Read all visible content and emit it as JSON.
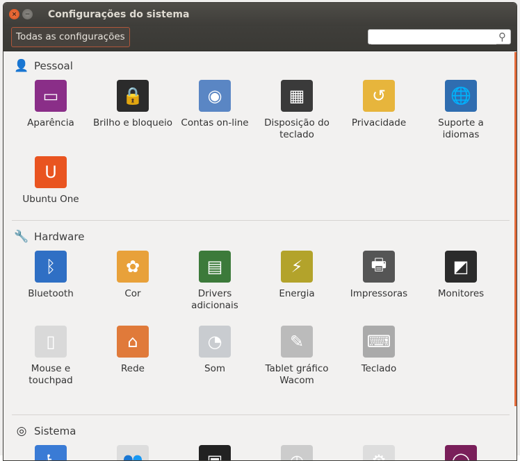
{
  "window": {
    "title": "Configurações do sistema",
    "close": "×",
    "minimize": "−"
  },
  "toolbar": {
    "all_settings": "Todas as configurações",
    "search_placeholder": "",
    "search_value": ""
  },
  "sections": [
    {
      "title": "Pessoal",
      "icon": "person-icon",
      "glyph": "👤",
      "items": [
        {
          "label": "Aparência",
          "icon": "appearance-icon",
          "color": "#8a2e88",
          "glyph": "▭"
        },
        {
          "label": "Brilho e bloqueio",
          "icon": "lock-screen-icon",
          "color": "#2b2b2b",
          "glyph": "🔒"
        },
        {
          "label": "Contas on-line",
          "icon": "online-accounts-icon",
          "color": "#5a86c4",
          "glyph": "◉"
        },
        {
          "label": "Disposição do teclado",
          "icon": "display-layout-icon",
          "color": "#3a3a3a",
          "glyph": "▦"
        },
        {
          "label": "Privacidade",
          "icon": "privacy-icon",
          "color": "#e7b53c",
          "glyph": "↺"
        },
        {
          "label": "Suporte a idiomas",
          "icon": "language-icon",
          "color": "#2f6db0",
          "glyph": "🌐"
        },
        {
          "label": "Ubuntu One",
          "icon": "ubuntu-one-icon",
          "color": "#e95420",
          "glyph": "U"
        }
      ]
    },
    {
      "title": "Hardware",
      "icon": "wrench-icon",
      "glyph": "🔧",
      "items": [
        {
          "label": "Bluetooth",
          "icon": "bluetooth-icon",
          "color": "#2f6fc4",
          "glyph": "ᛒ"
        },
        {
          "label": "Cor",
          "icon": "color-icon",
          "color": "#e8a13a",
          "glyph": "✿"
        },
        {
          "label": "Drivers adicionais",
          "icon": "drivers-icon",
          "color": "#3c7a3a",
          "glyph": "▤"
        },
        {
          "label": "Energia",
          "icon": "power-icon",
          "color": "#b3a32b",
          "glyph": "⚡"
        },
        {
          "label": "Impressoras",
          "icon": "printer-icon",
          "color": "#555",
          "glyph": "🖶"
        },
        {
          "label": "Monitores",
          "icon": "monitor-icon",
          "color": "#2b2b2b",
          "glyph": "◩"
        },
        {
          "label": "Mouse e touchpad",
          "icon": "mouse-icon",
          "color": "#d9d9d9",
          "glyph": "▯"
        },
        {
          "label": "Rede",
          "icon": "network-icon",
          "color": "#e07a3a",
          "glyph": "⌂"
        },
        {
          "label": "Som",
          "icon": "sound-icon",
          "color": "#c9ccd0",
          "glyph": "◔"
        },
        {
          "label": "Tablet gráfico Wacom",
          "icon": "wacom-tablet-icon",
          "color": "#bbb",
          "glyph": "✎"
        },
        {
          "label": "Teclado",
          "icon": "keyboard-icon",
          "color": "#aaa",
          "glyph": "⌨"
        }
      ]
    },
    {
      "title": "Sistema",
      "icon": "ubuntu-logo-icon",
      "glyph": "◎",
      "items": [
        {
          "label": "",
          "icon": "accessibility-icon",
          "color": "#3a7bd5",
          "glyph": "♿"
        },
        {
          "label": "",
          "icon": "users-icon",
          "color": "#ddd",
          "glyph": "👥"
        },
        {
          "label": "",
          "icon": "backup-icon",
          "color": "#222",
          "glyph": "▣"
        },
        {
          "label": "",
          "icon": "time-date-icon",
          "color": "#ccc",
          "glyph": "◷"
        },
        {
          "label": "",
          "icon": "details-icon",
          "color": "#ddd",
          "glyph": "⚙"
        },
        {
          "label": "",
          "icon": "software-updates-icon",
          "color": "#7a1f5a",
          "glyph": "◯"
        }
      ]
    }
  ]
}
